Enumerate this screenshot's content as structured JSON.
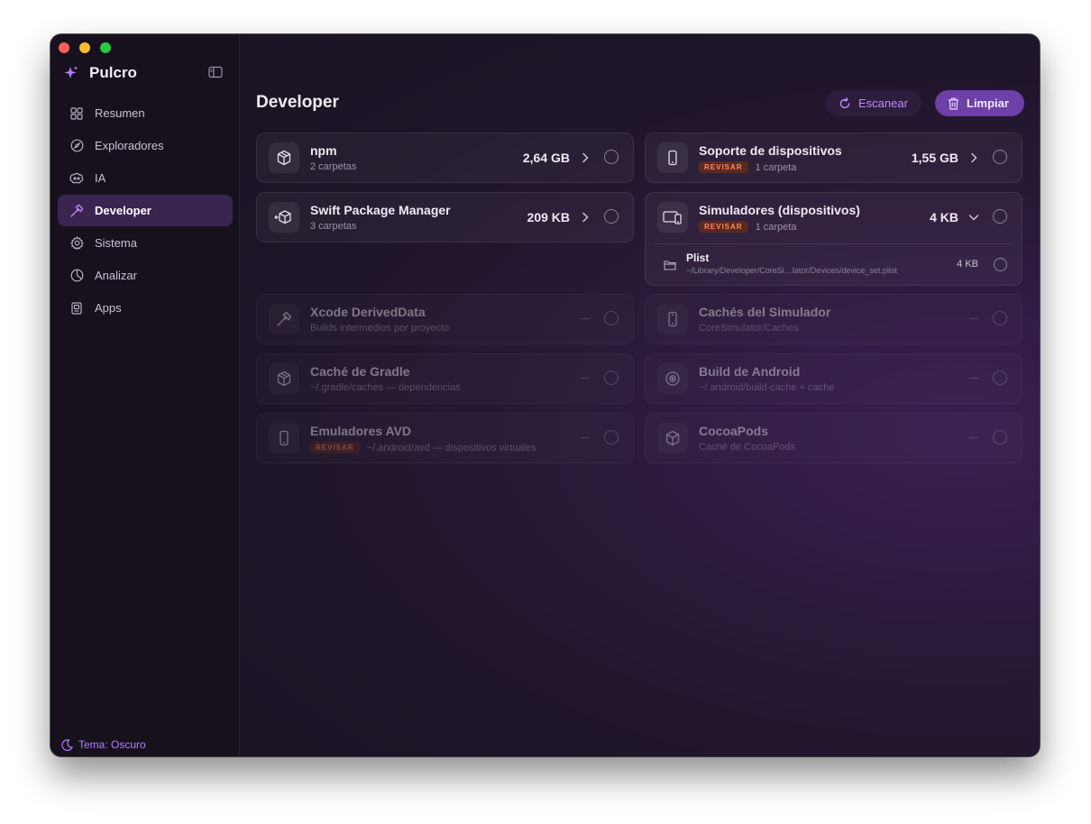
{
  "app": {
    "name": "Pulcro"
  },
  "sidebar": {
    "items": [
      {
        "label": "Resumen",
        "icon": "grid-icon"
      },
      {
        "label": "Exploradores",
        "icon": "compass-icon"
      },
      {
        "label": "IA",
        "icon": "brain-icon"
      },
      {
        "label": "Developer",
        "icon": "hammer-icon",
        "active": true
      },
      {
        "label": "Sistema",
        "icon": "gear-icon"
      },
      {
        "label": "Analizar",
        "icon": "pie-chart-icon"
      },
      {
        "label": "Apps",
        "icon": "apps-icon"
      }
    ],
    "theme_label": "Tema: Oscuro"
  },
  "main": {
    "title": "Developer",
    "scan_label": "Escanear",
    "clean_label": "Limpiar"
  },
  "cards": [
    {
      "title": "npm",
      "subtitle": "2 carpetas",
      "size": "2,64 GB",
      "icon": "box-icon"
    },
    {
      "title": "Soporte de dispositivos",
      "badge": "REVISAR",
      "subtitle": "1 carpeta",
      "size": "1,55 GB",
      "icon": "phone-icon"
    },
    {
      "title": "Swift Package Manager",
      "subtitle": "3 carpetas",
      "size": "209 KB",
      "icon": "package-arrow-icon"
    },
    {
      "title": "Simuladores (dispositivos)",
      "badge": "REVISAR",
      "subtitle": "1 carpeta",
      "size": "4 KB",
      "icon": "devices-icon",
      "expanded": {
        "title": "Plist",
        "path": "~/Library/Developer/CoreSi…lator/Devices/device_set.plist",
        "size": "4 KB"
      }
    },
    {
      "title": "Xcode DerivedData",
      "subtitle": "Builds intermedios por proyecto",
      "size": "—",
      "icon": "hammer-icon"
    },
    {
      "title": "Cachés del Simulador",
      "subtitle": "CoreSimulator/Caches",
      "size": "—",
      "icon": "phone-icon"
    },
    {
      "title": "Caché de Gradle",
      "subtitle": "~/.gradle/caches — dependencias",
      "size": "—",
      "icon": "box-icon"
    },
    {
      "title": "Build de Android",
      "subtitle": "~/.android/build-cache + cache",
      "size": "—",
      "icon": "android-icon"
    },
    {
      "title": "Emuladores AVD",
      "badge": "REVISAR",
      "subtitle": "~/.android/avd — dispositivos virtuales",
      "size": "—",
      "icon": "phone-icon"
    },
    {
      "title": "CocoaPods",
      "subtitle": "Caché de CocoaPods",
      "size": "—",
      "icon": "cube-icon"
    }
  ],
  "colors": {
    "accent": "#b57bff",
    "badge": "#ff8a5a",
    "clean_button": "#6d3fa8"
  }
}
